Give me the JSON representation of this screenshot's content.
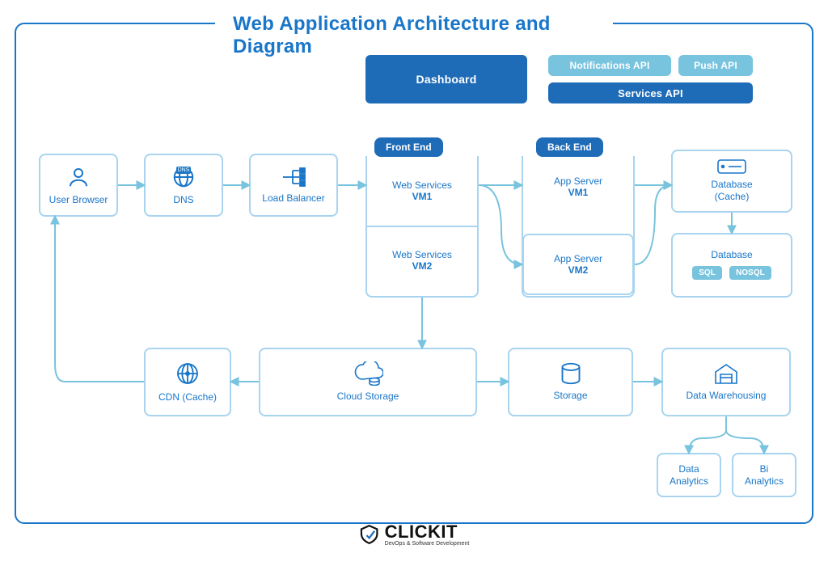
{
  "title": "Web Application Architecture and Diagram",
  "top": {
    "dashboard": "Dashboard",
    "notifications": "Notifications API",
    "push": "Push API",
    "services": "Services API"
  },
  "nodes": {
    "user_browser": "User Browser",
    "dns": "DNS",
    "load_balancer": "Load Balancer",
    "cdn": "CDN (Cache)",
    "cloud_storage": "Cloud Storage",
    "storage": "Storage",
    "warehousing": "Data Warehousing",
    "data_analytics": "Data\nAnalytics",
    "bi_analytics": "Bi\nAnalytics",
    "db_cache": "Database\n(Cache)",
    "db_main": "Database",
    "sql": "SQL",
    "nosql": "NOSQL"
  },
  "groups": {
    "front_end": {
      "head": "Front End",
      "cell1a": "Web Services",
      "cell1b": "VM1",
      "cell2a": "Web Services",
      "cell2b": "VM2"
    },
    "back_end": {
      "head": "Back End",
      "cell1a": "App Server",
      "cell1b": "VM1",
      "cell2a": "App Server",
      "cell2b": "VM2"
    }
  },
  "brand": {
    "name": "CLICKIT",
    "tag": "DevOps & Software Development"
  },
  "colors": {
    "blue": "#1976c9",
    "dark": "#1e6bb8",
    "light": "#78c3de",
    "border": "#a8d4ef"
  }
}
